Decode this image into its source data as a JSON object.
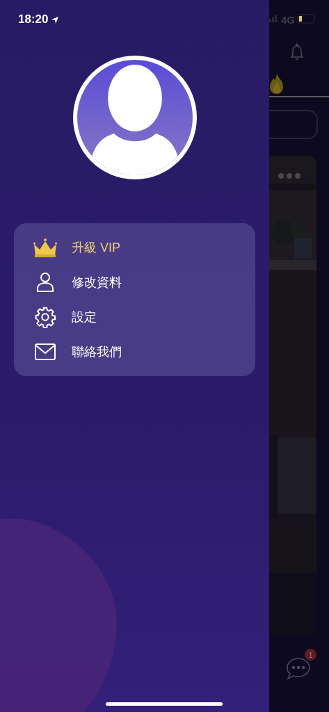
{
  "status_bar": {
    "time": "18:20",
    "network": "4G"
  },
  "menu": [
    {
      "kind": "vip",
      "label": "升級 VIP"
    },
    {
      "kind": "profile",
      "label": "修改資料"
    },
    {
      "kind": "settings",
      "label": "設定"
    },
    {
      "kind": "contact",
      "label": "聯絡我們"
    }
  ],
  "background_app": {
    "chat_badge": "1"
  }
}
